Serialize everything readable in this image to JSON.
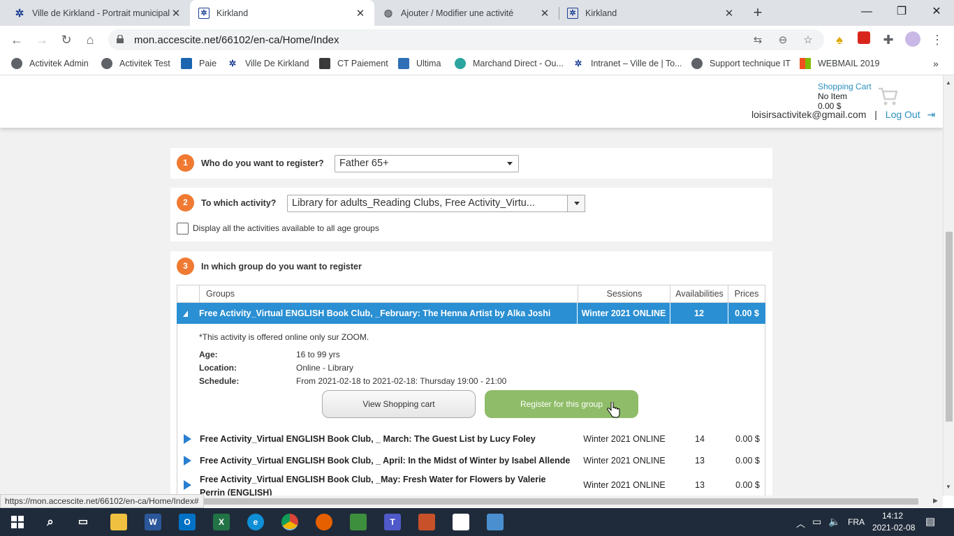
{
  "browser": {
    "tabs": [
      {
        "title": "Ville de Kirkland - Portrait municipal",
        "icon": "kirkland-logo-icon"
      },
      {
        "title": "Kirkland",
        "icon": "kirkland-logo-icon"
      },
      {
        "title": "Ajouter / Modifier une activité",
        "icon": "globe-icon"
      },
      {
        "title": "Kirkland",
        "icon": "kirkland-logo-icon"
      }
    ],
    "url": "mon.accescite.net/66102/en-ca/Home/Index",
    "bookmarks": [
      "Activitek Admin",
      "Activitek Test",
      "Paie",
      "Ville De Kirkland",
      "CT Paiement",
      "Ultima",
      "Marchand Direct - Ou...",
      "Intranet – Ville de | To...",
      "Support technique IT",
      "WEBMAIL 2019"
    ],
    "status_url": "https://mon.accescite.net/66102/en-ca/Home/Index#"
  },
  "header": {
    "cart_label": "Shopping Cart",
    "cart_items": "No Item",
    "cart_total": "0.00 $",
    "email": "loisirsactivitek@gmail.com",
    "separator": "|",
    "logout": "Log Out"
  },
  "step1": {
    "num": "1",
    "label": "Who do you want to register?",
    "value": "Father 65+"
  },
  "step2": {
    "num": "2",
    "label": "To which activity?",
    "value": "Library for adults_Reading Clubs, Free Activity_Virtu...",
    "checkbox_label": "Display all the activities available to all age groups"
  },
  "step3": {
    "num": "3",
    "label": "In which group do you want to register"
  },
  "grid": {
    "headers": {
      "groups": "Groups",
      "sessions": "Sessions",
      "availabilities": "Availabilities",
      "prices": "Prices"
    },
    "selected": {
      "name": "Free Activity_Virtual ENGLISH Book Club, _February: The Henna Artist by Alka Joshi",
      "session": "Winter 2021 ONLINE",
      "avail": "12",
      "price": "0.00 $"
    },
    "detail": {
      "note": "*This activity is offered online only sur ZOOM.",
      "age_label": "Age:",
      "age": "16 to 99 yrs",
      "location_label": "Location:",
      "location": "Online - Library",
      "schedule_label": "Schedule:",
      "schedule": "From 2021-02-18 to 2021-02-18: Thursday 19:00 - 21:00",
      "view_cart": "View Shopping cart",
      "register": "Register for this group"
    },
    "rows": [
      {
        "name": "Free Activity_Virtual ENGLISH Book Club, _ March: The Guest List by Lucy Foley",
        "session": "Winter 2021 ONLINE",
        "avail": "14",
        "price": "0.00 $"
      },
      {
        "name": "Free Activity_Virtual ENGLISH Book Club, _ April: In the Midst of Winter by Isabel Allende",
        "session": "Winter 2021 ONLINE",
        "avail": "13",
        "price": "0.00 $"
      },
      {
        "name": "Free Activity_Virtual ENGLISH Book Club, _May: Fresh Water for Flowers by Valerie Perrin (ENGLISH)",
        "session": "Winter 2021 ONLINE",
        "avail": "13",
        "price": "0.00 $"
      }
    ]
  },
  "taskbar": {
    "lang": "FRA",
    "time": "14:12",
    "date": "2021-02-08"
  }
}
